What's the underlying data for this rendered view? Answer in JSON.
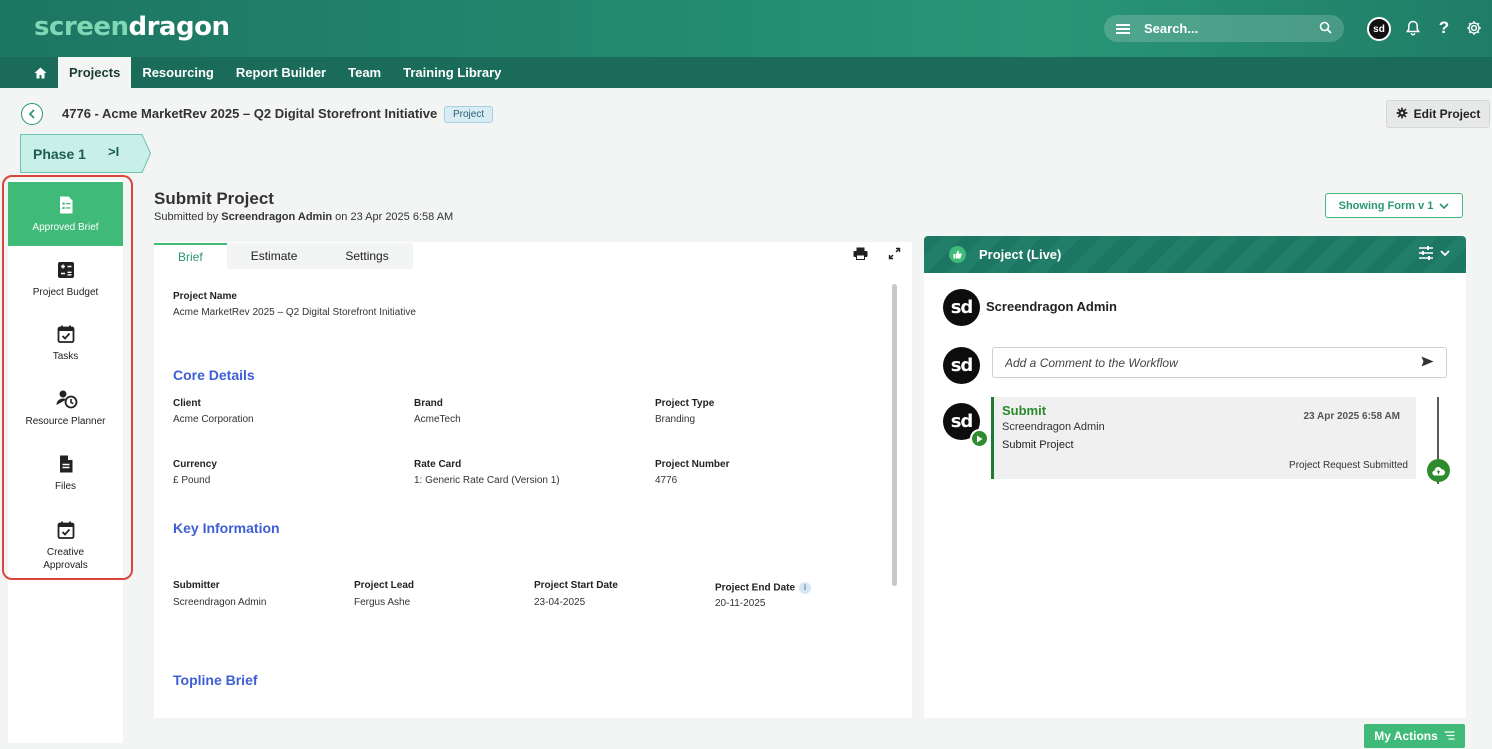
{
  "header": {
    "logo_part1": "screen",
    "logo_part2": "dragon",
    "search_placeholder": "Search...",
    "avatar_initials": "sd"
  },
  "nav": {
    "items": [
      "Projects",
      "Resourcing",
      "Report Builder",
      "Team",
      "Training Library"
    ],
    "active": "Projects"
  },
  "project": {
    "title": "4776 - Acme MarketRev 2025 – Q2 Digital Storefront Initiative",
    "badge": "Project",
    "edit_label": "Edit Project",
    "phase_label": "Phase 1"
  },
  "sidebar": {
    "items": [
      {
        "label": "Approved Brief",
        "icon": "form-doc-icon",
        "active": true
      },
      {
        "label": "Project Budget",
        "icon": "calculator-icon",
        "active": false
      },
      {
        "label": "Tasks",
        "icon": "calendar-check-icon",
        "active": false
      },
      {
        "label": "Resource Planner",
        "icon": "person-clock-icon",
        "active": false
      },
      {
        "label": "Files",
        "icon": "file-icon",
        "active": false
      },
      {
        "label": "Creative Approvals",
        "icon": "calendar-check-icon",
        "active": false
      }
    ]
  },
  "form": {
    "title": "Submit Project",
    "submitted_prefix": "Submitted by ",
    "submitted_by": "Screendragon Admin",
    "submitted_suffix": " on 23 Apr 2025 6:58 AM",
    "showing_label": "Showing Form v 1",
    "tabs": [
      "Brief",
      "Estimate",
      "Settings"
    ],
    "active_tab": "Brief",
    "project_name_label": "Project Name",
    "project_name_value": "Acme MarketRev 2025 – Q2 Digital Storefront Initiative",
    "core_details": {
      "heading": "Core Details",
      "client_label": "Client",
      "client_value": "Acme Corporation",
      "brand_label": "Brand",
      "brand_value": "AcmeTech",
      "type_label": "Project Type",
      "type_value": "Branding",
      "currency_label": "Currency",
      "currency_value": "£ Pound",
      "rate_label": "Rate Card",
      "rate_value": "1: Generic Rate Card (Version 1)",
      "number_label": "Project Number",
      "number_value": "4776"
    },
    "key_info": {
      "heading": "Key Information",
      "submitter_label": "Submitter",
      "submitter_value": "Screendragon Admin",
      "lead_label": "Project Lead",
      "lead_value": "Fergus Ashe",
      "start_label": "Project Start Date",
      "start_value": "23-04-2025",
      "end_label": "Project End Date",
      "end_value": "20-11-2025"
    },
    "topline_heading": "Topline Brief"
  },
  "workflow": {
    "title": "Project (Live)",
    "user": "Screendragon Admin",
    "avatar_initials": "sd",
    "comment_placeholder": "Add a Comment to the Workflow",
    "step": {
      "title": "Submit",
      "by": "Screendragon Admin",
      "action": "Submit Project",
      "date": "23 Apr 2025 6:58 AM",
      "status": "Project Request Submitted"
    }
  },
  "footer": {
    "my_actions": "My Actions"
  },
  "colors": {
    "brand_green": "#3fba79",
    "header_dark": "#1d7563",
    "section_blue": "#3e5ed6",
    "highlight_red": "#d9463b"
  }
}
